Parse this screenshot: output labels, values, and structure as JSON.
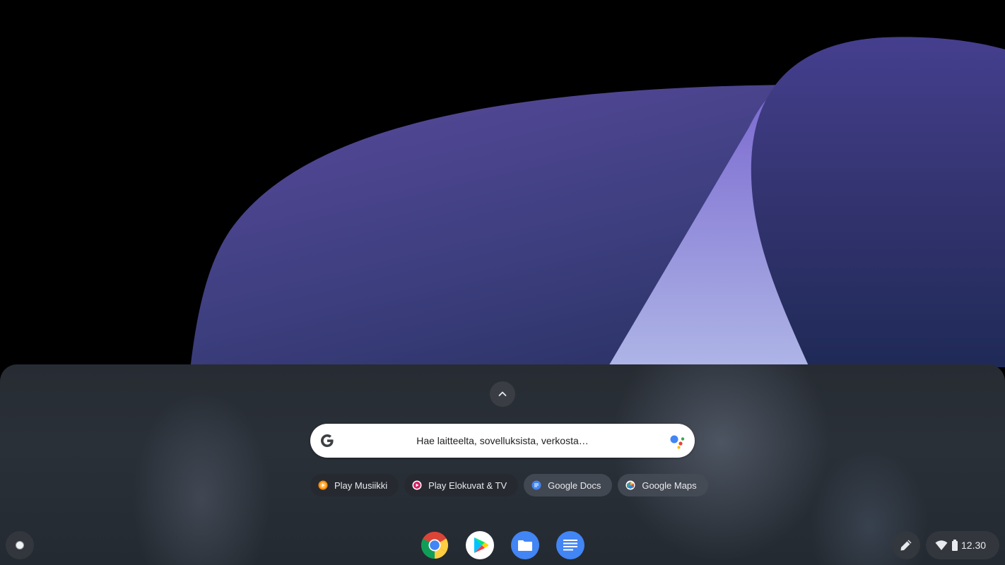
{
  "search": {
    "placeholder": "Hae laitteelta, sovelluksista, verkosta…"
  },
  "suggestions": [
    {
      "label": "Play Musiikki",
      "icon": "play-music-icon"
    },
    {
      "label": "Play Elokuvat & TV",
      "icon": "play-movies-icon"
    },
    {
      "label": "Google Docs",
      "icon": "google-docs-icon"
    },
    {
      "label": "Google Maps",
      "icon": "google-maps-icon"
    }
  ],
  "shelf": {
    "apps": [
      {
        "name": "chrome",
        "icon": "chrome-icon",
        "running": true
      },
      {
        "name": "play-store",
        "icon": "play-store-icon",
        "running": false
      },
      {
        "name": "files",
        "icon": "files-icon",
        "running": false
      },
      {
        "name": "docs",
        "icon": "google-docs-icon",
        "running": false
      }
    ]
  },
  "status": {
    "time": "12.30",
    "icons": [
      "wifi-icon",
      "battery-icon"
    ]
  },
  "colors": {
    "google_blue": "#4285f4",
    "google_red": "#ea4335",
    "google_yellow": "#fbbc04",
    "google_green": "#34a853"
  }
}
